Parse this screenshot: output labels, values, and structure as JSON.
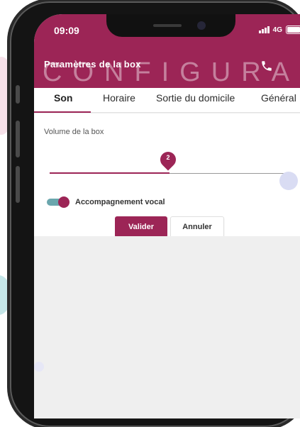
{
  "status_bar": {
    "time": "09:09",
    "network": "4G"
  },
  "header": {
    "title": "Paramètres de la box",
    "watermark": "CONFIGURA"
  },
  "tabs": [
    {
      "label": "Son",
      "active": true
    },
    {
      "label": "Horaire",
      "active": false
    },
    {
      "label": "Sortie du domicile",
      "active": false
    },
    {
      "label": "Général",
      "active": false
    }
  ],
  "settings": {
    "volume_label": "Volume de la box",
    "volume_value": "2",
    "volume_fraction": 0.5,
    "vocal_label": "Accompagnement vocal",
    "vocal_enabled": true
  },
  "buttons": {
    "validate": "Valider",
    "cancel": "Annuler"
  },
  "colors": {
    "brand": "#9c2556",
    "toggle_track": "#6aa6ad",
    "background": "#efefef"
  },
  "icons": [
    "phone-icon",
    "signal-icon",
    "battery-icon"
  ]
}
